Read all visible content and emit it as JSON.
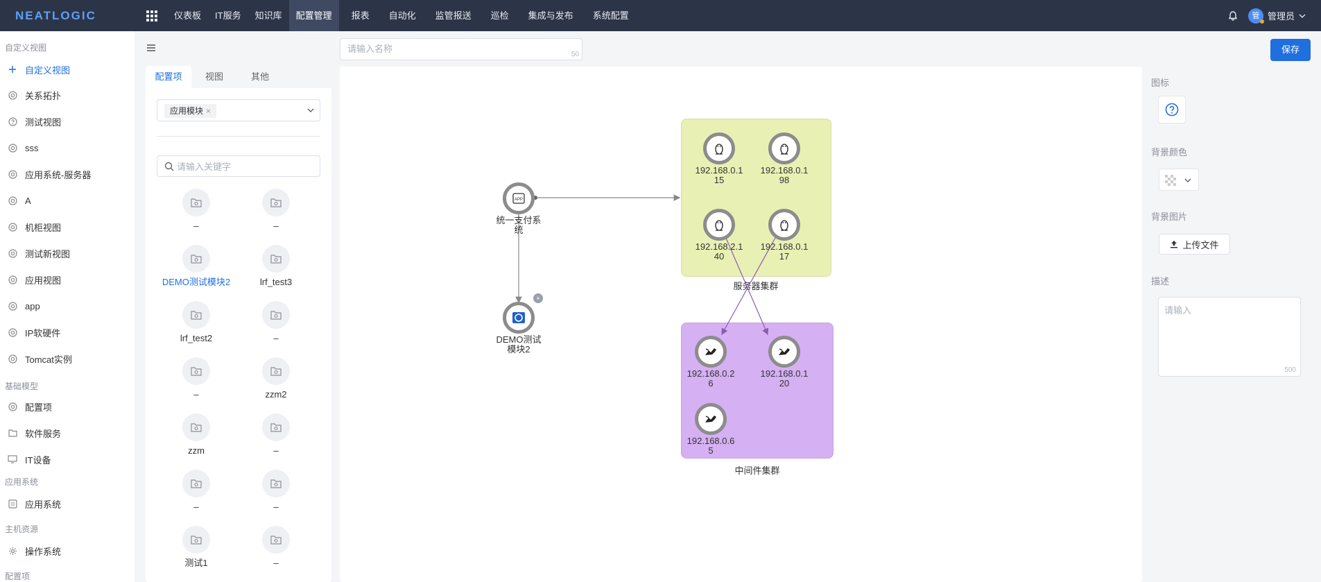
{
  "topnav": {
    "logo": "NEATLOGIC",
    "items": [
      "仪表板",
      "IT服务",
      "知识库",
      "配置管理",
      "报表",
      "自动化",
      "监管报送",
      "巡检",
      "集成与发布",
      "系统配置"
    ],
    "active": "配置管理",
    "user_initial": "管",
    "user_name": "管理员"
  },
  "sidebar": {
    "groups": [
      {
        "title": "自定义视图",
        "items": [
          {
            "label": "自定义视图",
            "icon": "plus-icon",
            "highlighted": true
          },
          {
            "label": "关系拓扑",
            "icon": "circle-icon"
          },
          {
            "label": "测试视图",
            "icon": "question-circle-icon"
          },
          {
            "label": "sss",
            "icon": "circle-icon"
          },
          {
            "label": "应用系统-服务器",
            "icon": "circle-icon"
          },
          {
            "label": "A",
            "icon": "circle-icon"
          },
          {
            "label": "机柜视图",
            "icon": "circle-icon"
          },
          {
            "label": "测试新视图",
            "icon": "circle-icon"
          },
          {
            "label": "应用视图",
            "icon": "circle-icon"
          },
          {
            "label": "app",
            "icon": "circle-icon"
          },
          {
            "label": "IP软硬件",
            "icon": "circle-icon"
          },
          {
            "label": "Tomcat实例",
            "icon": "circle-icon"
          }
        ]
      },
      {
        "title": "基础模型",
        "items": [
          {
            "label": "配置项",
            "icon": "circle-icon"
          },
          {
            "label": "软件服务",
            "icon": "folder-icon"
          },
          {
            "label": "IT设备",
            "icon": "monitor-icon"
          }
        ]
      },
      {
        "title": "应用系统",
        "items": [
          {
            "label": "应用系统",
            "icon": "app-icon"
          }
        ]
      },
      {
        "title": "主机资源",
        "items": [
          {
            "label": "操作系统",
            "icon": "gear-icon"
          }
        ]
      },
      {
        "title": "配置项",
        "items": []
      }
    ]
  },
  "panel": {
    "tabs": [
      "配置项",
      "视图",
      "其他"
    ],
    "active_tab": "配置项",
    "selected_chip": "应用模块",
    "search_placeholder": "请输入关键字",
    "ci_items": [
      {
        "label": "–"
      },
      {
        "label": "–"
      },
      {
        "label": "DEMO测试模块2",
        "highlighted": true
      },
      {
        "label": "lrf_test3"
      },
      {
        "label": "lrf_test2"
      },
      {
        "label": "–"
      },
      {
        "label": "–"
      },
      {
        "label": "zzm2"
      },
      {
        "label": "zzm"
      },
      {
        "label": "–"
      },
      {
        "label": "–"
      },
      {
        "label": "–"
      },
      {
        "label": "测试1"
      },
      {
        "label": "–"
      }
    ]
  },
  "header": {
    "name_placeholder": "请输入名称",
    "name_limit": "50",
    "save_label": "保存"
  },
  "canvas": {
    "groups": [
      {
        "label": "服务器集群",
        "color": "#e9f0b4"
      },
      {
        "label": "中间件集群",
        "color": "#d5b0f2"
      }
    ],
    "nodes": {
      "app": "统一支付系统",
      "module": "DEMO测试模块2",
      "s1": "192.168.0.115",
      "s2": "192.168.0.198",
      "s3": "192.168.2.140",
      "s4": "192.168.0.117",
      "m1": "192.168.0.26",
      "m2": "192.168.0.120",
      "m3": "192.168.0.65"
    },
    "delete_mark": "×"
  },
  "right": {
    "icon_label": "图标",
    "bg_color_label": "背景颜色",
    "bg_image_label": "背景图片",
    "upload_label": "上传文件",
    "desc_label": "描述",
    "desc_placeholder": "请输入",
    "desc_limit": "500"
  }
}
